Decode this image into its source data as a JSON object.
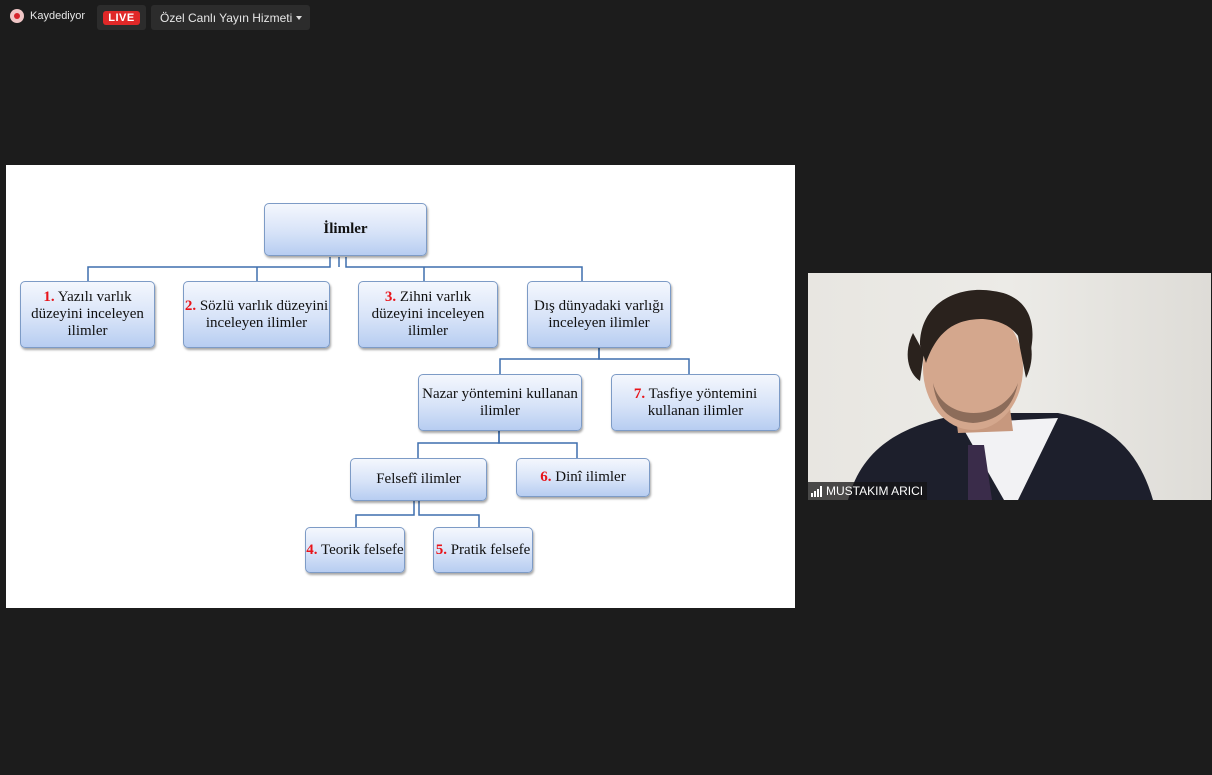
{
  "topbar": {
    "recording_label": "Kaydediyor",
    "live_label": "LIVE",
    "stream_label": "Özel Canlı Yayın Hizmeti"
  },
  "slide": {
    "root": "İlimler",
    "level1": [
      {
        "num": "1.",
        "text": "Yazılı varlık düzeyini inceleyen ilimler"
      },
      {
        "num": "2.",
        "text": "Sözlü varlık düzeyini inceleyen ilimler"
      },
      {
        "num": "3.",
        "text": "Zihni varlık düzeyini inceleyen ilimler"
      },
      {
        "num": "",
        "text": "Dış dünyadaki varlığı inceleyen ilimler"
      }
    ],
    "level2": [
      {
        "num": "",
        "text": "Nazar yöntemini kullanan ilimler"
      },
      {
        "num": "7.",
        "text": "Tasfiye yöntemini kullanan ilimler"
      }
    ],
    "level3": [
      {
        "num": "",
        "text": "Felsefî ilimler"
      },
      {
        "num": "6.",
        "text": "Dinî ilimler"
      }
    ],
    "level4": [
      {
        "num": "4.",
        "text": "Teorik felsefe"
      },
      {
        "num": "5.",
        "text": "Pratik felsefe"
      }
    ]
  },
  "video": {
    "participant_name": "MUSTAKIM ARICI",
    "signal_icon": "signal-bars-icon"
  },
  "colors": {
    "background": "#1c1c1c",
    "live_red": "#e02828",
    "number_red": "#e8141a",
    "connector": "#3f6fae"
  }
}
